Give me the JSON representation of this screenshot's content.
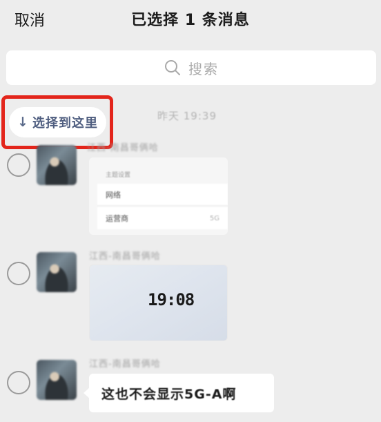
{
  "header": {
    "cancel_label": "取消",
    "title": "已选择 1 条消息"
  },
  "search": {
    "placeholder": "搜索",
    "icon": "search-icon"
  },
  "select_to_here": {
    "label": "选择到这里",
    "arrow": "↓",
    "highlight_color": "#e3251b"
  },
  "timestamp": "昨天 19:39",
  "messages": [
    {
      "sender": "江西-南昌哥俩哈",
      "type": "card",
      "card": {
        "head": "主题设置",
        "rows": [
          {
            "label": "网络",
            "value": ""
          },
          {
            "label": "运营商",
            "value": "5G"
          }
        ]
      },
      "selected": false
    },
    {
      "sender": "江西-南昌哥俩哈",
      "type": "image",
      "clock": "19:08",
      "selected": false
    },
    {
      "sender": "江西-南昌哥俩哈",
      "type": "text",
      "text": "这也不会显示5G-A啊",
      "selected": false
    }
  ],
  "colors": {
    "background": "#ededed",
    "bubble": "#ffffff",
    "accent_text": "#4e5d7f"
  }
}
